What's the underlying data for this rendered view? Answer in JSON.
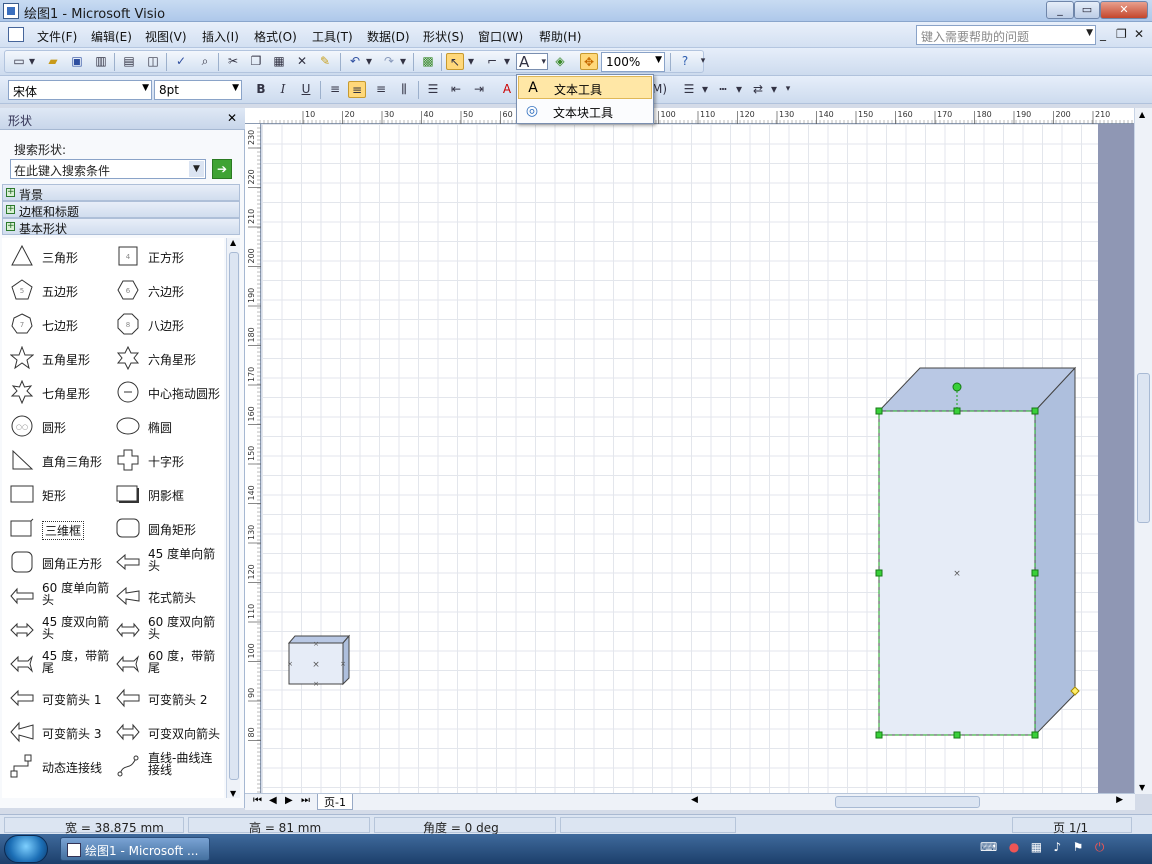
{
  "window": {
    "title": "绘图1 - Microsoft Visio",
    "minimize_label": "_",
    "maximize_label": "▭",
    "close_label": "✕"
  },
  "menu": {
    "items": [
      "文件(F)",
      "编辑(E)",
      "视图(V)",
      "插入(I)",
      "格式(O)",
      "工具(T)",
      "数据(D)",
      "形状(S)",
      "窗口(W)",
      "帮助(H)"
    ],
    "help_placeholder": "键入需要帮助的问题"
  },
  "toolbar_standard": {
    "zoom": "100%"
  },
  "toolbar_format": {
    "font": "宋体",
    "size": "8pt",
    "partial_label": "M)"
  },
  "dropdown": {
    "items": [
      {
        "label": "文本工具",
        "icon": "text-tool-icon",
        "highlighted": true
      },
      {
        "label": "文本块工具",
        "icon": "text-block-tool-icon",
        "highlighted": false
      }
    ]
  },
  "shapes_panel": {
    "title": "形状",
    "close_label": "✕",
    "search_label": "搜索形状:",
    "search_value": "在此键入搜索条件",
    "stencils": [
      "背景",
      "边框和标题",
      "基本形状"
    ],
    "shapes": [
      "三角形",
      "正方形",
      "五边形",
      "六边形",
      "七边形",
      "八边形",
      "五角星形",
      "六角星形",
      "七角星形",
      "中心拖动圆形",
      "圆形",
      "椭圆",
      "直角三角形",
      "十字形",
      "矩形",
      "阴影框",
      "三维框",
      "圆角矩形",
      "圆角正方形",
      "45 度单向箭头",
      "60 度单向箭头",
      "花式箭头",
      "45 度双向箭头",
      "60 度双向箭头",
      "45 度，带箭尾",
      "60 度，带箭尾",
      "可变箭头 1",
      "可变箭头 2",
      "可变箭头 3",
      "可变双向箭头",
      "动态连接线",
      "直线-曲线连接线"
    ]
  },
  "ruler": {
    "top_ticks": [
      "10",
      "20",
      "30",
      "40",
      "50",
      "60",
      "70",
      "80",
      "90",
      "100",
      "110",
      "120",
      "130",
      "140",
      "150",
      "160",
      "170",
      "180",
      "190",
      "200",
      "210"
    ],
    "left_ticks": [
      "230",
      "220",
      "210",
      "200",
      "190",
      "180",
      "170",
      "160",
      "150",
      "140",
      "130",
      "120",
      "110",
      "100",
      "90",
      "80"
    ]
  },
  "page": {
    "tab": "页-1"
  },
  "status": {
    "width": "宽 = 38.875 mm",
    "height": "高 = 81 mm",
    "angle": "角度 = 0 deg",
    "page": "页 1/1"
  },
  "taskbar": {
    "button": "绘图1 - Microsoft ..."
  },
  "colors": {
    "shape_fill": "#e6ecf7",
    "shape_side": "#aebfdd",
    "shape_top": "#b9c8e4",
    "selection": "#1aa31a",
    "accent": "#ffd87a"
  }
}
